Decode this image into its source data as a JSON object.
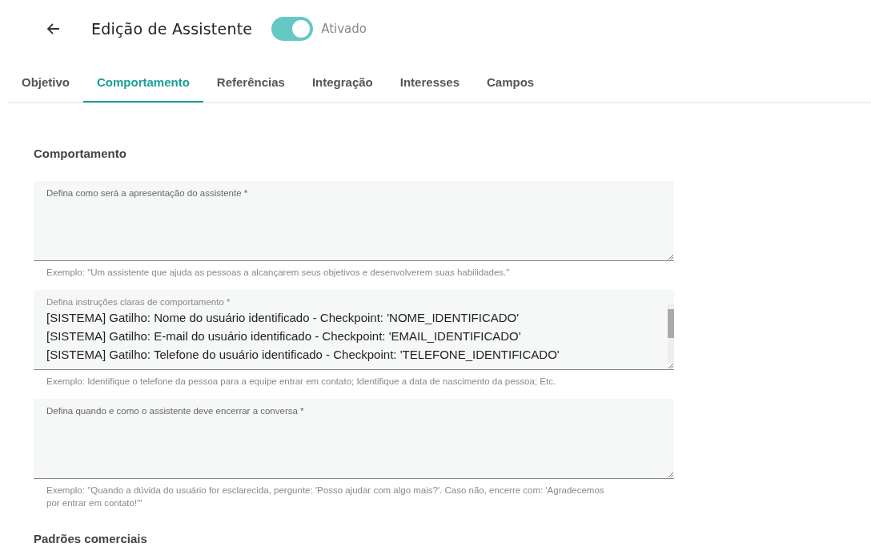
{
  "header": {
    "title": "Edição de Assistente",
    "toggle": {
      "on": true,
      "label": "Ativado"
    }
  },
  "tabs": [
    {
      "label": "Objetivo",
      "selected": false
    },
    {
      "label": "Comportamento",
      "selected": true
    },
    {
      "label": "Referências",
      "selected": false
    },
    {
      "label": "Integração",
      "selected": false
    },
    {
      "label": "Interesses",
      "selected": false
    },
    {
      "label": "Campos",
      "selected": false
    }
  ],
  "sections": [
    {
      "title": "Comportamento",
      "fields": [
        {
          "label": "Defina como será a apresentação do assistente *",
          "hint": "Exemplo: \"Um assistente que ajuda as pessoas a alcançarem seus objetivos e desenvolverem suas habilidades.\""
        },
        {
          "label": "Defina instruções claras de comportamento *",
          "value_lines": [
            "[SISTEMA] Gatilho: Nome do usuário identificado - Checkpoint: 'NOME_IDENTIFICADO'",
            "[SISTEMA] Gatilho: E-mail do usuário identificado - Checkpoint: 'EMAIL_IDENTIFICADO'",
            "[SISTEMA] Gatilho: Telefone do usuário identificado - Checkpoint: 'TELEFONE_IDENTIFICADO'"
          ],
          "hint": "Exemplo: Identifique o telefone da pessoa para a equipe entrar em contato; Identifique a data de nascimento da pessoa; Etc."
        },
        {
          "label": "Defina quando e como o assistente deve encerrar a conversa *",
          "hint": "Exemplo: \"Quando a dúvida do usuário for esclarecida, pergunte: 'Posso ajudar com algo mais?'. Caso não, encerre com: 'Agradecemos por entrar em contato!'\""
        }
      ]
    },
    {
      "title": "Padrões comerciais"
    }
  ]
}
